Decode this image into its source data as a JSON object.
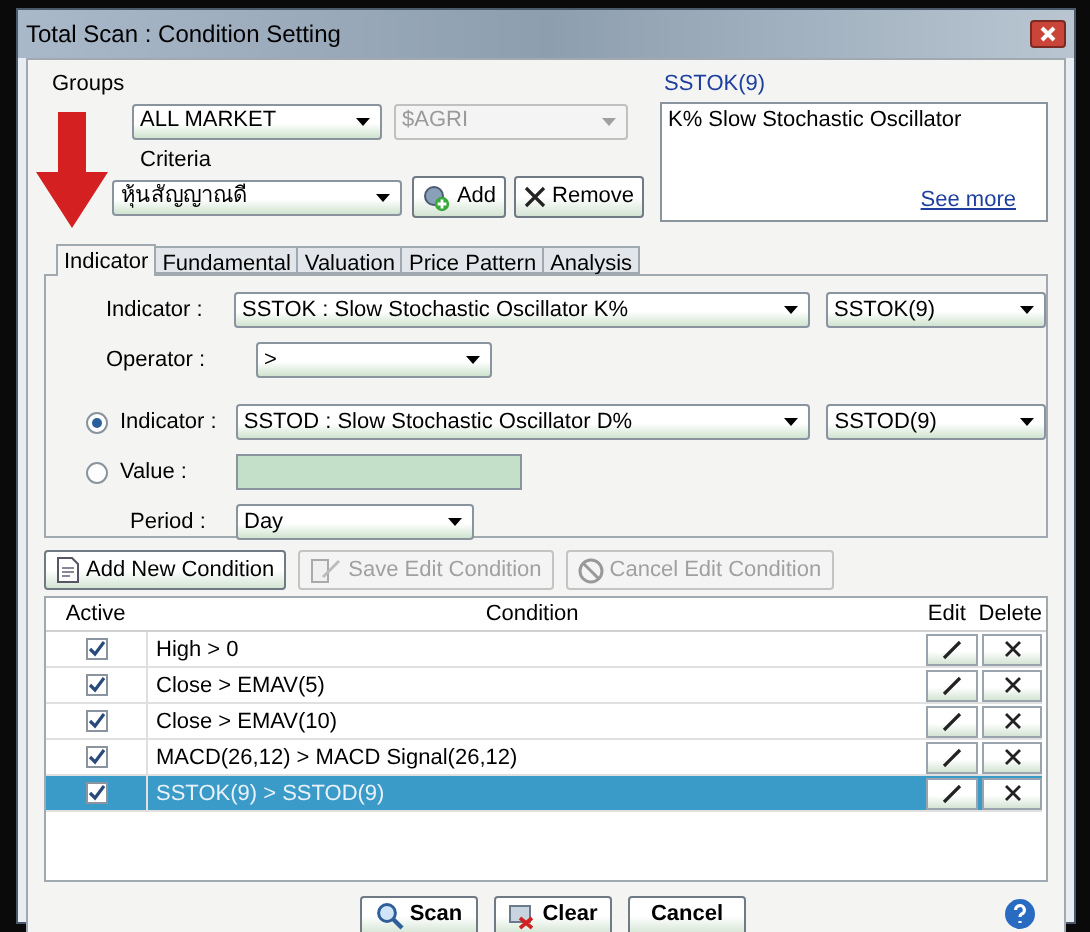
{
  "window": {
    "title": "Total Scan : Condition Setting"
  },
  "groups": {
    "label": "Groups",
    "market": "ALL MARKET",
    "symbol": "$AGRI",
    "symbol_disabled": true
  },
  "criteria": {
    "label": "Criteria",
    "value": "หุ้นสัญญาณดี",
    "buttons": [
      {
        "kind": "add",
        "label": "Add"
      },
      {
        "kind": "remove",
        "label": "Remove"
      }
    ]
  },
  "info": {
    "title": "SSTOK(9)",
    "text": "K% Slow Stochastic Oscillator",
    "link": "See more"
  },
  "tabs": [
    {
      "label": "Indicator",
      "selected": true
    },
    {
      "label": "Fundamental",
      "selected": false
    },
    {
      "label": "Valuation",
      "selected": false
    },
    {
      "label": "Price Pattern",
      "selected": false
    },
    {
      "label": "Analysis",
      "selected": false
    }
  ],
  "form": {
    "indicator_label": "Indicator :",
    "indicator": "SSTOK : Slow Stochastic Oscillator K%",
    "indicator_param": "SSTOK(9)",
    "operator_label": "Operator :",
    "operator": ">",
    "compare": [
      {
        "kind": "indicator",
        "label": "Indicator :",
        "selected": true,
        "value": "SSTOD : Slow Stochastic Oscillator D%",
        "param": "SSTOD(9)"
      },
      {
        "kind": "value",
        "label": "Value :",
        "selected": false
      }
    ],
    "period_label": "Period :",
    "period": "Day"
  },
  "actions": [
    {
      "kind": "add",
      "label": "Add New Condition",
      "disabled": false
    },
    {
      "kind": "save",
      "label": "Save Edit Condition",
      "disabled": true
    },
    {
      "kind": "cancel",
      "label": "Cancel Edit Condition",
      "disabled": true
    }
  ],
  "table": {
    "columns": [
      "Active",
      "Condition",
      "Edit",
      "Delete"
    ],
    "rows": [
      {
        "active": true,
        "condition": "High > 0",
        "selected": false
      },
      {
        "active": true,
        "condition": "Close > EMAV(5)",
        "selected": false
      },
      {
        "active": true,
        "condition": "Close > EMAV(10)",
        "selected": false
      },
      {
        "active": true,
        "condition": "MACD(26,12) > MACD Signal(26,12)",
        "selected": false
      },
      {
        "active": true,
        "condition": "SSTOK(9) > SSTOD(9)",
        "selected": true
      }
    ]
  },
  "footer": {
    "buttons": [
      {
        "kind": "scan",
        "label": "Scan"
      },
      {
        "kind": "clear",
        "label": "Clear"
      },
      {
        "kind": "cancel",
        "label": "Cancel"
      }
    ]
  }
}
